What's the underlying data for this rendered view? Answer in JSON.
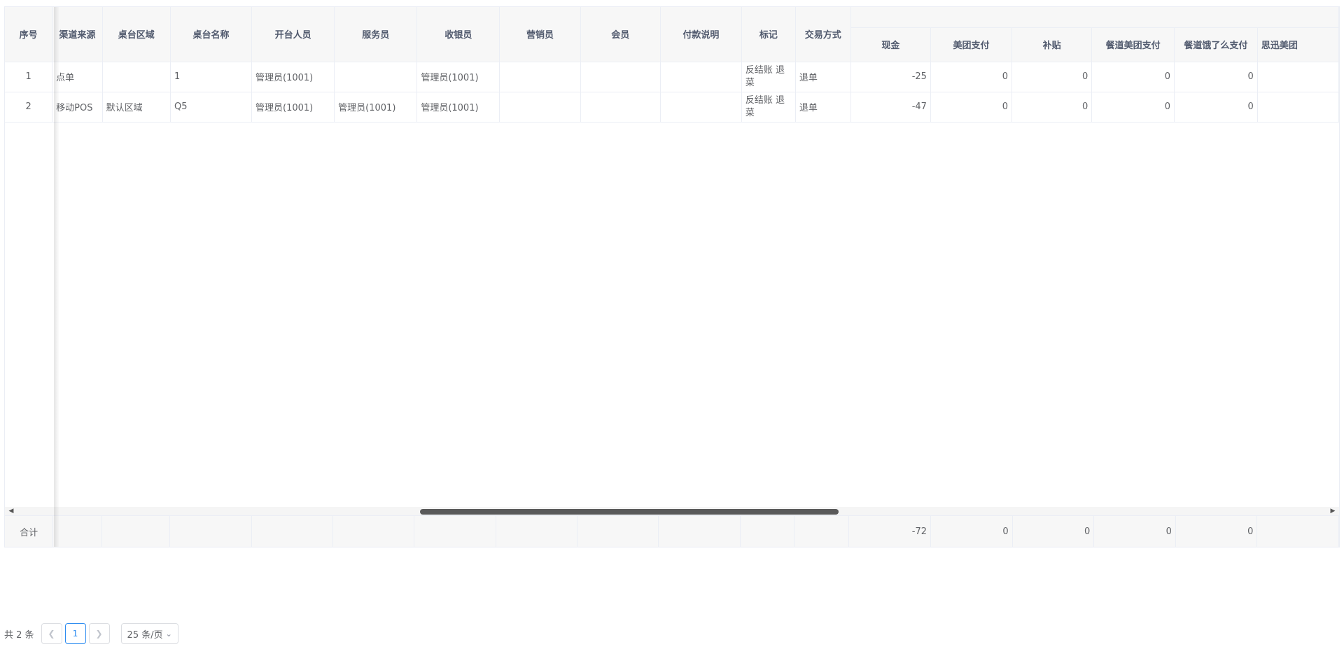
{
  "table": {
    "columns": {
      "seq": "序号",
      "channel": "渠道来源",
      "area": "桌台区域",
      "table_name": "桌台名称",
      "opener": "开台人员",
      "waiter": "服务员",
      "cashier": "收银员",
      "marketer": "营销员",
      "member": "会员",
      "payment_note": "付款说明",
      "mark": "标记",
      "trade_type": "交易方式",
      "cash": "现金",
      "meituan_pay": "美团支付",
      "subsidy": "补贴",
      "cd_meituan_pay": "餐道美团支付",
      "cd_eleme_pay": "餐道饿了么支付",
      "sixun_pay": "思迅美团"
    },
    "rows": [
      {
        "seq": "1",
        "channel": "点单",
        "area": "",
        "table_name": "1",
        "opener": "管理员(1001)",
        "waiter": "",
        "cashier": "管理员(1001)",
        "marketer": "",
        "member": "",
        "payment_note": "",
        "mark": "反结账 退菜",
        "trade_type": "退单",
        "cash": "-25",
        "meituan_pay": "0",
        "subsidy": "0",
        "cd_meituan_pay": "0",
        "cd_eleme_pay": "0"
      },
      {
        "seq": "2",
        "channel": "移动POS",
        "area": "默认区域",
        "table_name": "Q5",
        "opener": "管理员(1001)",
        "waiter": "管理员(1001)",
        "cashier": "管理员(1001)",
        "marketer": "",
        "member": "",
        "payment_note": "",
        "mark": "反结账 退菜",
        "trade_type": "退单",
        "cash": "-47",
        "meituan_pay": "0",
        "subsidy": "0",
        "cd_meituan_pay": "0",
        "cd_eleme_pay": "0"
      }
    ],
    "summary": {
      "label": "合计",
      "cash": "-72",
      "meituan_pay": "0",
      "subsidy": "0",
      "cd_meituan_pay": "0",
      "cd_eleme_pay": "0"
    }
  },
  "pagination": {
    "total_text": "共 2 条",
    "prev_icon": "chevron-left-icon",
    "current_page": "1",
    "next_icon": "chevron-right-icon",
    "page_size": "25 条/页"
  },
  "colors": {
    "header_bg": "#f7f7f7",
    "border": "#ebeef5",
    "accent": "#2d8cf0",
    "scroll_thumb": "#5a5a5a"
  }
}
